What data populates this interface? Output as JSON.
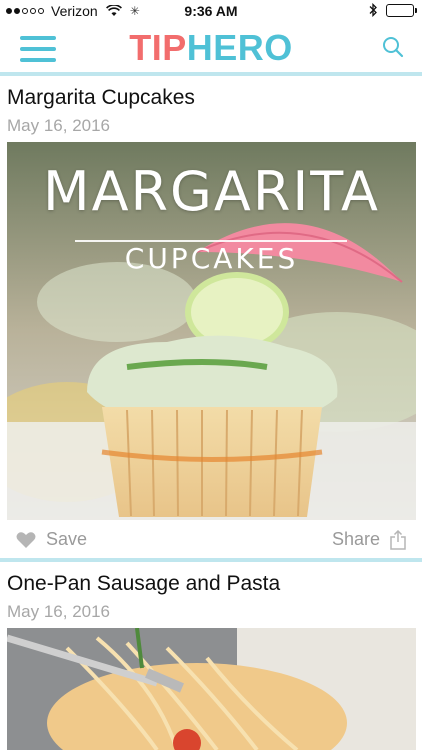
{
  "status_bar": {
    "carrier": "Verizon",
    "time": "9:36 AM",
    "signal_bars": 2,
    "signal_total": 5
  },
  "nav": {
    "logo_part1": "TIP",
    "logo_part2": "HERO",
    "menu_icon": "hamburger-menu-icon",
    "search_icon": "search-icon",
    "colors": {
      "tip": "#f26d6d",
      "hero": "#4fc1d6",
      "accent_bar": "#bfe6ee"
    }
  },
  "feed": {
    "items": [
      {
        "title": "Margarita Cupcakes",
        "date": "May 16, 2016",
        "image_title": "MARGARITA",
        "image_subtitle": "CUPCAKES",
        "save_label": "Save",
        "share_label": "Share"
      },
      {
        "title": "One-Pan Sausage and Pasta",
        "date": "May 16, 2016"
      }
    ]
  }
}
